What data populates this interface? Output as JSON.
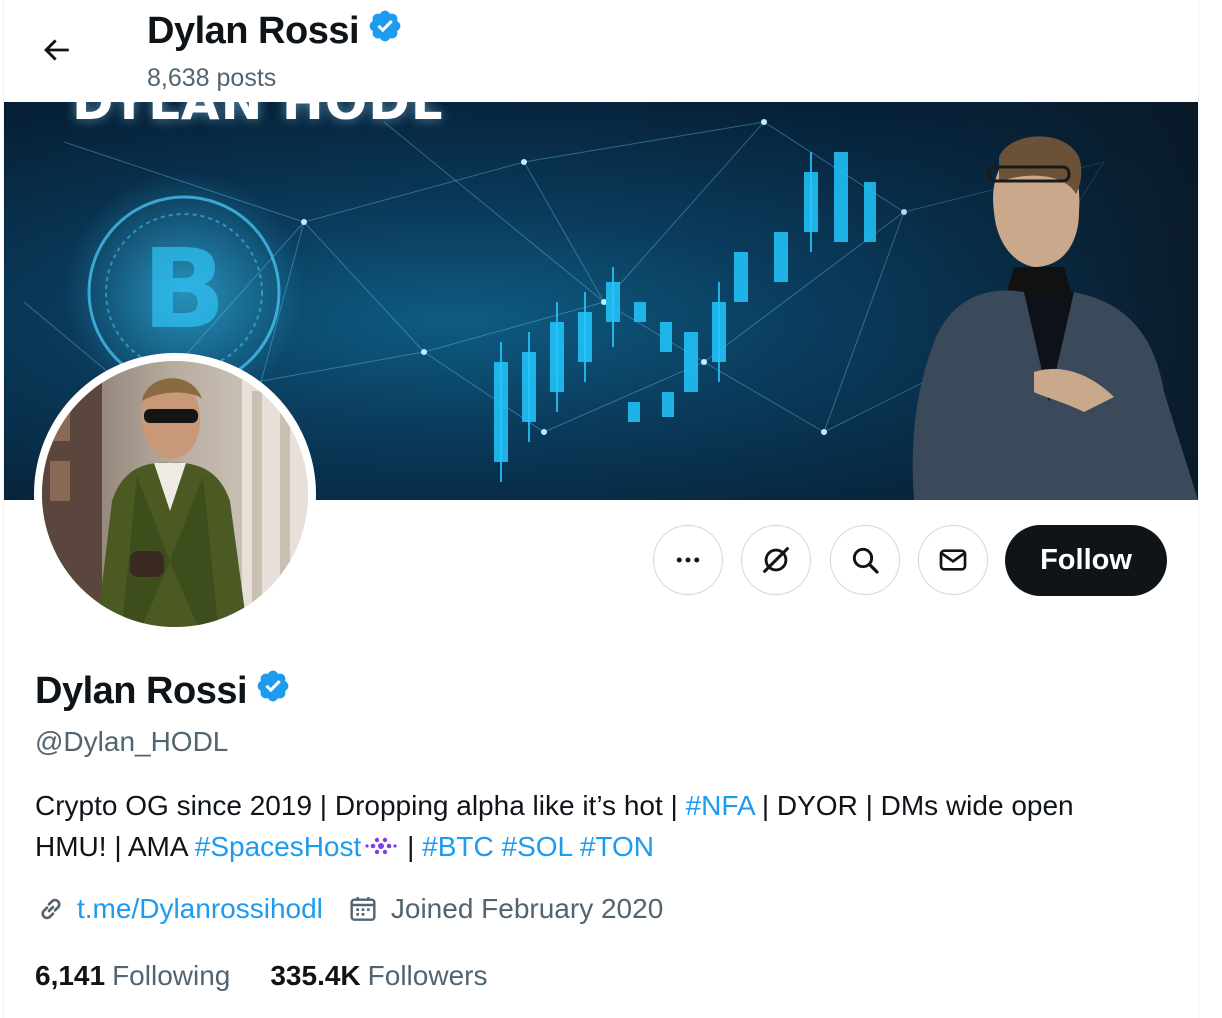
{
  "header": {
    "name": "Dylan Rossi",
    "posts_count": "8,638 posts"
  },
  "banner": {
    "title": "DYLAN HODL"
  },
  "actions": {
    "follow_label": "Follow",
    "more_icon": "ellipsis-icon",
    "grok_icon": "grok-icon",
    "search_icon": "search-icon",
    "message_icon": "envelope-icon"
  },
  "profile": {
    "name": "Dylan Rossi",
    "handle": "@Dylan_HODL",
    "bio_line1_a": "Crypto OG since 2019 | Dropping alpha like it’s hot | ",
    "bio_tag_nfa": "#NFA",
    "bio_line1_b": " | DYOR | DMs wide open",
    "bio_line2_a": "HMU! | AMA ",
    "bio_tag_spaces": "#SpacesHost",
    "bio_sep": " | ",
    "bio_tag_btc": "#BTC",
    "bio_tag_sol": "#SOL",
    "bio_tag_ton": "#TON",
    "link": "t.me/Dylanrossihodl",
    "joined": "Joined February 2020"
  },
  "stats": {
    "following_count": "6,141",
    "following_label": "Following",
    "followers_count": "335.4K",
    "followers_label": "Followers"
  },
  "colors": {
    "accent": "#1d9bf0",
    "text": "#0f1419",
    "secondary": "#536471",
    "follow_bg": "#0f1419"
  }
}
